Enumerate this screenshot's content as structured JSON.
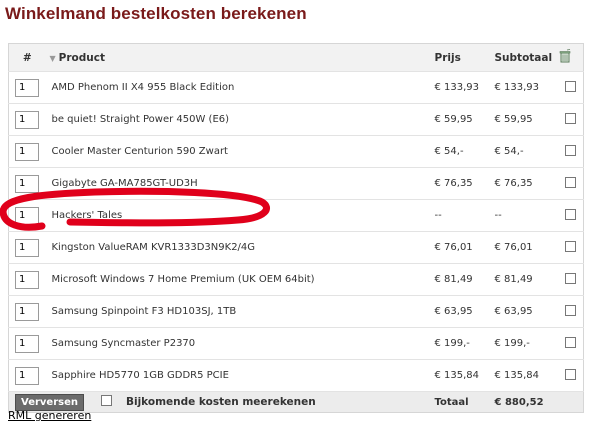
{
  "title": "Winkelmand bestelkosten berekenen",
  "headers": {
    "num": "#",
    "product": "Product",
    "price": "Prijs",
    "subtotal": "Subtotaal"
  },
  "rows": [
    {
      "qty": "1",
      "product": "AMD Phenom II X4 955 Black Edition",
      "price": "€ 133,93",
      "subtotal": "€ 133,93"
    },
    {
      "qty": "1",
      "product": "be quiet! Straight Power 450W (E6)",
      "price": "€ 59,95",
      "subtotal": "€ 59,95"
    },
    {
      "qty": "1",
      "product": "Cooler Master Centurion 590 Zwart",
      "price": "€ 54,-",
      "subtotal": "€ 54,-"
    },
    {
      "qty": "1",
      "product": "Gigabyte GA-MA785GT-UD3H",
      "price": "€ 76,35",
      "subtotal": "€ 76,35"
    },
    {
      "qty": "1",
      "product": "Hackers' Tales",
      "price": "--",
      "subtotal": "--"
    },
    {
      "qty": "1",
      "product": "Kingston ValueRAM KVR1333D3N9K2/4G",
      "price": "€ 76,01",
      "subtotal": "€ 76,01"
    },
    {
      "qty": "1",
      "product": "Microsoft Windows 7 Home Premium (UK OEM 64bit)",
      "price": "€ 81,49",
      "subtotal": "€ 81,49"
    },
    {
      "qty": "1",
      "product": "Samsung Spinpoint F3 HD103SJ, 1TB",
      "price": "€ 63,95",
      "subtotal": "€ 63,95"
    },
    {
      "qty": "1",
      "product": "Samsung Syncmaster P2370",
      "price": "€ 199,-",
      "subtotal": "€ 199,-"
    },
    {
      "qty": "1",
      "product": "Sapphire HD5770 1GB GDDR5 PCIE",
      "price": "€ 135,84",
      "subtotal": "€ 135,84"
    }
  ],
  "footer": {
    "refresh_button": "Verversen",
    "extra_costs_label": "Bijkomende kosten meerekenen",
    "total_label": "Totaal",
    "total_value": "€ 880,52"
  },
  "link": "RML genereren",
  "colors": {
    "title": "#7a1a1a",
    "highlight_mark": "#e0001b"
  },
  "icons": {
    "header_delete": "trash-icon",
    "sort": "sort-arrow-icon"
  }
}
